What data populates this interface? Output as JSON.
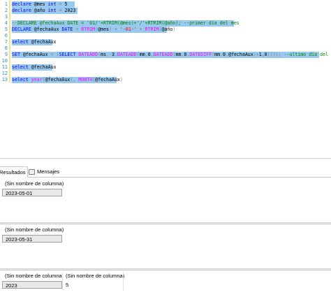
{
  "editor": {
    "line_numbers": [
      "1",
      "2",
      "3",
      "4",
      "5",
      "6",
      "7",
      "8",
      "9",
      "10",
      "11",
      "12",
      "13"
    ],
    "lines": [
      [
        [
          "kw",
          "declare "
        ],
        [
          "tx",
          "@mes "
        ],
        [
          "kw",
          "int "
        ],
        [
          "gy",
          "= "
        ],
        [
          "tx",
          "5"
        ]
      ],
      [
        [
          "kw",
          "declare "
        ],
        [
          "tx",
          "@año "
        ],
        [
          "kw",
          "int "
        ],
        [
          "gy",
          "= "
        ],
        [
          "tx",
          "2023"
        ]
      ],
      [],
      [
        [
          "cm",
          "--DECLARE @fechaAux DATE = '01/'+RTRIM(@mes)+'/'+RTRIM(@año); --primer dia del mes"
        ]
      ],
      [
        [
          "kw",
          "DECLARE "
        ],
        [
          "tx",
          "@fechaAux "
        ],
        [
          "kw",
          "DATE "
        ],
        [
          "gy",
          "= "
        ],
        [
          "fn",
          "RTRIM"
        ],
        [
          "gy",
          "("
        ],
        [
          "tx",
          "@mes"
        ],
        [
          "gy",
          ") + "
        ],
        [
          "st",
          "'-01-' "
        ],
        [
          "gy",
          "+ "
        ],
        [
          "fn",
          "RTRIM"
        ],
        [
          "gy",
          "("
        ],
        [
          "tx",
          "@año"
        ],
        [
          "gy",
          ")"
        ]
      ],
      [],
      [
        [
          "kw",
          "select "
        ],
        [
          "tx",
          "@fechaAux"
        ]
      ],
      [],
      [
        [
          "kw",
          "SET "
        ],
        [
          "tx",
          "@fechaAux "
        ],
        [
          "gy",
          "= ("
        ],
        [
          "kw",
          "SELECT "
        ],
        [
          "fn",
          "DATEADD"
        ],
        [
          "gy",
          "("
        ],
        [
          "tx",
          "ms"
        ],
        [
          "gy",
          ",-"
        ],
        [
          "tx",
          "3"
        ],
        [
          "gy",
          ","
        ],
        [
          "fn",
          "DATEADD"
        ],
        [
          "gy",
          "("
        ],
        [
          "tx",
          "mm"
        ],
        [
          "gy",
          ","
        ],
        [
          "tx",
          "0"
        ],
        [
          "gy",
          ","
        ],
        [
          "fn",
          "DATEADD"
        ],
        [
          "gy",
          "("
        ],
        [
          "tx",
          "mm"
        ],
        [
          "gy",
          ","
        ],
        [
          "tx",
          "0"
        ],
        [
          "gy",
          ","
        ],
        [
          "fn",
          "DATEDIFF"
        ],
        [
          "gy",
          "("
        ],
        [
          "tx",
          "mm"
        ],
        [
          "gy",
          ","
        ],
        [
          "tx",
          "0"
        ],
        [
          "gy",
          ","
        ],
        [
          "tx",
          "@fechaAux"
        ],
        [
          "gy",
          ")+"
        ],
        [
          "tx",
          "1"
        ],
        [
          "gy",
          ","
        ],
        [
          "tx",
          "0"
        ],
        [
          "gy",
          "))))"
        ],
        [
          "gy",
          "; "
        ],
        [
          "cm",
          "--ultimo dia del mes"
        ]
      ],
      [],
      [
        [
          "kw",
          "select "
        ],
        [
          "tx",
          "@fechaAux"
        ]
      ],
      [],
      [
        [
          "kw",
          "select "
        ],
        [
          "fn",
          "year"
        ],
        [
          "gy",
          "("
        ],
        [
          "tx",
          "@fechaAux"
        ],
        [
          "gy",
          "), "
        ],
        [
          "fn",
          "MONTH"
        ],
        [
          "gy",
          "("
        ],
        [
          "tx",
          "@fechaAux"
        ],
        [
          "gy",
          ")"
        ]
      ]
    ]
  },
  "tabs": [
    {
      "label": "Resultados",
      "icon": "results-grid-icon",
      "active": true
    },
    {
      "label": "Mensajes",
      "icon": "messages-icon",
      "active": false
    }
  ],
  "results": [
    {
      "columns": [
        "(Sin nombre de columna)"
      ],
      "rows": [
        [
          "2023-05-01"
        ]
      ]
    },
    {
      "columns": [
        "(Sin nombre de columna)"
      ],
      "rows": [
        [
          "2023-05-31"
        ]
      ]
    },
    {
      "columns": [
        "(Sin nombre de columna)",
        "(Sin nombre de columna)"
      ],
      "rows": [
        [
          "2023",
          "5"
        ]
      ]
    }
  ]
}
